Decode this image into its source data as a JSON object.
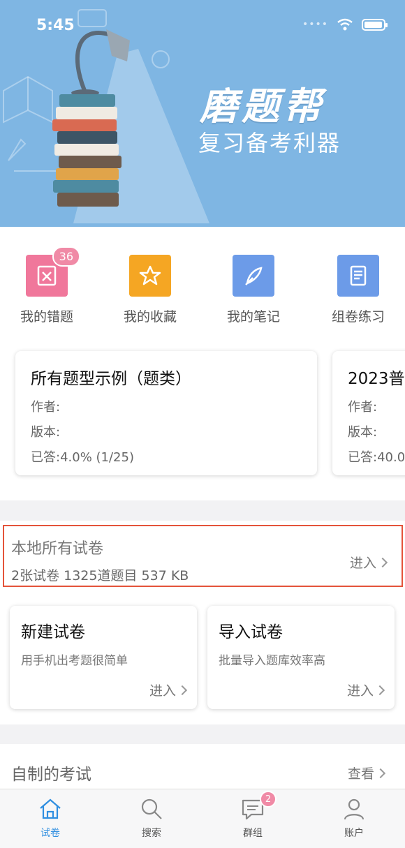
{
  "status": {
    "time": "5:45"
  },
  "banner": {
    "title": "磨题帮",
    "subtitle": "复习备考利器"
  },
  "quick_actions": [
    {
      "label": "我的错题",
      "icon": "wrong-questions-icon",
      "color": "#f0779b",
      "badge": "36"
    },
    {
      "label": "我的收藏",
      "icon": "star-icon",
      "color": "#f5a623"
    },
    {
      "label": "我的笔记",
      "icon": "feather-icon",
      "color": "#6c9be8"
    },
    {
      "label": "组卷练习",
      "icon": "document-icon",
      "color": "#6c9be8"
    }
  ],
  "books": [
    {
      "title": "所有题型示例（题类）",
      "author": "作者:",
      "version": "版本:",
      "answered": "已答:4.0% (1/25)"
    },
    {
      "title": "2023普",
      "author": "作者:",
      "version": "版本:",
      "answered": "已答:40.0"
    }
  ],
  "local": {
    "title": "本地所有试卷",
    "stats": "2张试卷  1325道题目 537 KB",
    "enter": "进入"
  },
  "actions": [
    {
      "title": "新建试卷",
      "desc": "用手机出考题很简单",
      "enter": "进入"
    },
    {
      "title": "导入试卷",
      "desc": "批量导入题库效率高",
      "enter": "进入"
    }
  ],
  "exams": {
    "title": "自制的考试",
    "view": "查看"
  },
  "tabs": [
    {
      "label": "试卷",
      "icon": "home-icon",
      "active": true
    },
    {
      "label": "搜索",
      "icon": "search-icon"
    },
    {
      "label": "群组",
      "icon": "chat-icon",
      "badge": "2"
    },
    {
      "label": "账户",
      "icon": "user-icon"
    }
  ],
  "colors": {
    "accent": "#2f8ee0",
    "banner": "#7fb6e3",
    "highlight": "#e4533a",
    "badge": "#f08aa6"
  }
}
